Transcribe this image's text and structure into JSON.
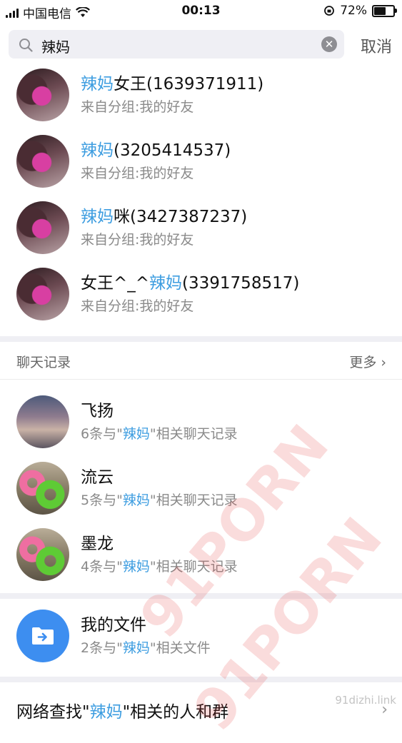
{
  "status_bar": {
    "carrier": "中国电信",
    "time": "00:13",
    "battery": "72%",
    "battery_level": 0.72
  },
  "search": {
    "query": "辣妈",
    "cancel_label": "取消"
  },
  "contacts": [
    {
      "pre": "",
      "hl": "辣妈",
      "post": "女王(1639371911)",
      "subtitle": "来自分组:我的好友"
    },
    {
      "pre": "",
      "hl": "辣妈",
      "post": "(3205414537)",
      "subtitle": "来自分组:我的好友"
    },
    {
      "pre": "",
      "hl": "辣妈",
      "post": "咪(3427387237)",
      "subtitle": "来自分组:我的好友"
    },
    {
      "pre": "女王^_^",
      "hl": "辣妈",
      "post": "(3391758517)",
      "subtitle": "来自分组:我的好友"
    }
  ],
  "chat_section": {
    "title": "聊天记录",
    "more_label": "更多"
  },
  "chats": [
    {
      "name": "飞扬",
      "sub_pre": "6条与\"",
      "sub_hl": "辣妈",
      "sub_post": "\"相关聊天记录"
    },
    {
      "name": "流云",
      "sub_pre": "5条与\"",
      "sub_hl": "辣妈",
      "sub_post": "\"相关聊天记录"
    },
    {
      "name": "墨龙",
      "sub_pre": "4条与\"",
      "sub_hl": "辣妈",
      "sub_post": "\"相关聊天记录"
    }
  ],
  "files": {
    "name": "我的文件",
    "sub_pre": "2条与\"",
    "sub_hl": "辣妈",
    "sub_post": "\"相关文件"
  },
  "web_search": {
    "pre": "网络查找\"",
    "hl": "辣妈",
    "post": "\"相关的人和群"
  },
  "watermark": {
    "text": "91PORN",
    "url": "91dizhi.link"
  },
  "colors": {
    "highlight": "#3d9de0",
    "file_icon_bg": "#3d8ef0",
    "section_gap": "#efeff4"
  }
}
